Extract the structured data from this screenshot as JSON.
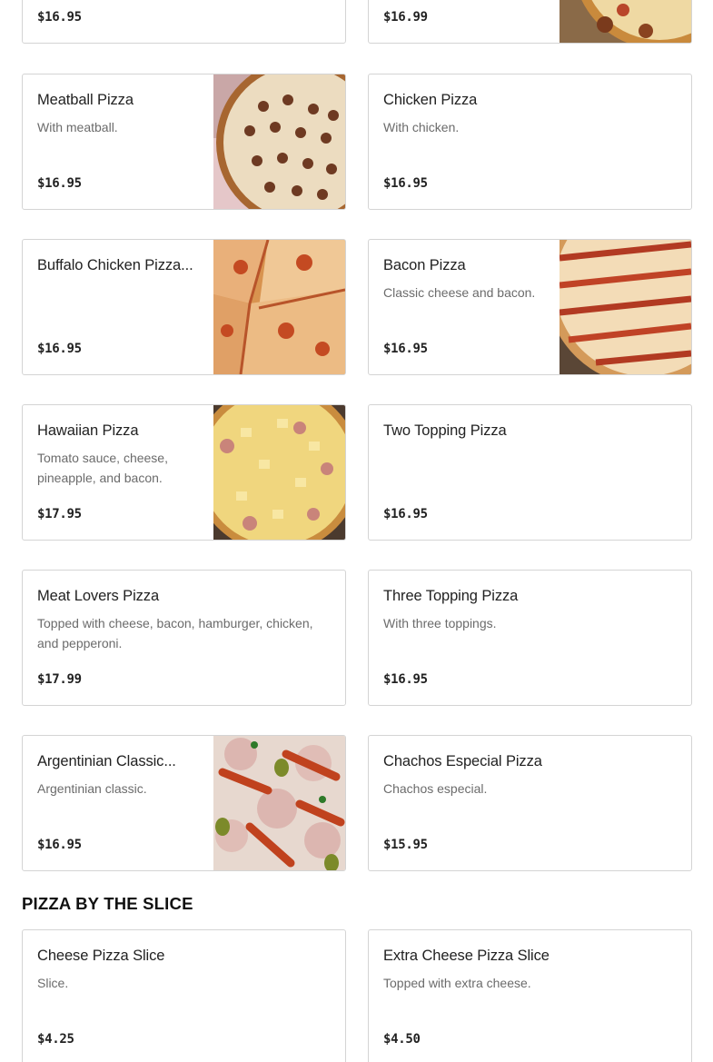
{
  "top_cards": [
    {
      "price": "$16.95"
    },
    {
      "price": "$16.99",
      "image": "pizza-photo"
    }
  ],
  "items": [
    {
      "name": "Meatball Pizza",
      "desc": "With meatball.",
      "price": "$16.95",
      "image": "meatball-pizza-photo"
    },
    {
      "name": "Chicken Pizza",
      "desc": "With chicken.",
      "price": "$16.95"
    },
    {
      "name": "Buffalo Chicken Pizza...",
      "desc": "",
      "price": "$16.95",
      "image": "buffalo-chicken-pizza-photo"
    },
    {
      "name": "Bacon Pizza",
      "desc": "Classic cheese and bacon.",
      "price": "$16.95",
      "image": "bacon-pizza-photo"
    },
    {
      "name": "Hawaiian Pizza",
      "desc": "Tomato sauce, cheese, pineapple, and bacon.",
      "price": "$17.95",
      "image": "hawaiian-pizza-photo"
    },
    {
      "name": "Two Topping Pizza",
      "desc": "",
      "price": "$16.95"
    },
    {
      "name": "Meat Lovers Pizza",
      "desc": "Topped with cheese, bacon, hamburger, chicken, and pepperoni.",
      "price": "$17.99"
    },
    {
      "name": "Three Topping Pizza",
      "desc": "With three toppings.",
      "price": "$16.95"
    },
    {
      "name": "Argentinian Classic...",
      "desc": "Argentinian classic.",
      "price": "$16.95",
      "image": "argentinian-pizza-photo"
    },
    {
      "name": "Chachos Especial Pizza",
      "desc": "Chachos especial.",
      "price": "$15.95"
    }
  ],
  "slice_section": {
    "title": "PIZZA BY THE SLICE",
    "items": [
      {
        "name": "Cheese Pizza Slice",
        "desc": "Slice.",
        "price": "$4.25"
      },
      {
        "name": "Extra Cheese Pizza Slice",
        "desc": "Topped with extra cheese.",
        "price": "$4.50"
      }
    ]
  }
}
